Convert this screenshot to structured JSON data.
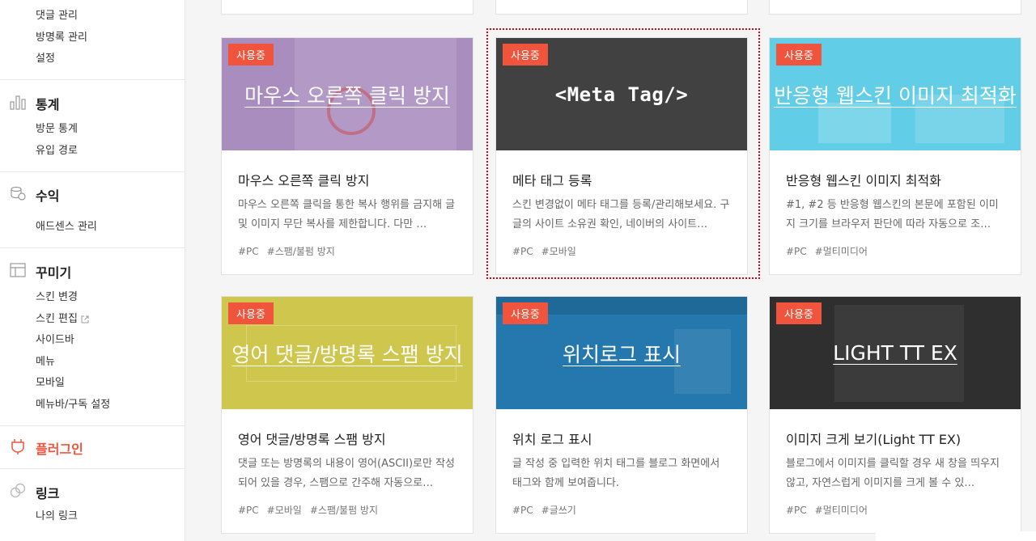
{
  "sidebar": {
    "comment_manage": "댓글 관리",
    "guestbook_manage": "방명록 관리",
    "settings": "설정",
    "stats": {
      "title": "통계",
      "items": [
        "방문 통계",
        "유입 경로"
      ]
    },
    "revenue": {
      "title": "수익",
      "items": [
        "애드센스 관리"
      ]
    },
    "decorate": {
      "title": "꾸미기",
      "items": [
        "스킨 변경",
        "스킨 편집",
        "사이드바",
        "메뉴",
        "모바일",
        "메뉴바/구독 설정"
      ]
    },
    "plugin": {
      "title": "플러그인"
    },
    "link": {
      "title": "링크",
      "items": [
        "나의 링크"
      ]
    }
  },
  "badge_label": "사용중",
  "cards": [
    {
      "thumb_text": "마우스 오른쪽 클릭 방지",
      "title": "마우스 오른쪽 클릭 방지",
      "desc": "마우스 오른쪽 클릭을 통한 복사 행위를 금지해 글 및 이미지 무단 복사를 제한합니다. 다만 …",
      "tags": [
        "#PC",
        "#스팸/불펌 방지"
      ],
      "color": "#a98dbf"
    },
    {
      "thumb_text": "<Meta Tag/>",
      "title": "메타 태그 등록",
      "desc": "스킨 변경없이 메타 태그를 등록/관리해보세요. 구글의 사이트 소유권 확인, 네이버의 사이트…",
      "tags": [
        "#PC",
        "#모바일"
      ],
      "color": "#414141"
    },
    {
      "thumb_text": "반응형 웹스킨 이미지 최적화",
      "title": "반응형 웹스킨 이미지 최적화",
      "desc": "#1, #2 등 반응형 웹스킨의 본문에 포함된 이미지 크기를 브라우저 판단에 따라 자동으로 조…",
      "tags": [
        "#PC",
        "#멀티미디어"
      ],
      "color": "#62cde6"
    },
    {
      "thumb_text": "영어 댓글/방명록 스팸 방지",
      "title": "영어 댓글/방명록 스팸 방지",
      "desc": "댓글 또는 방명록의 내용이 영어(ASCII)로만 작성되어 있을 경우, 스팸으로 간주해 자동으로…",
      "tags": [
        "#PC",
        "#모바일",
        "#스팸/불펌 방지"
      ],
      "color": "#cfc74d"
    },
    {
      "thumb_text": "위치로그 표시",
      "title": "위치 로그 표시",
      "desc": "글 작성 중 입력한 위치 태그를 블로그 화면에서 태그와 함께 보여줍니다.",
      "tags": [
        "#PC",
        "#글쓰기"
      ],
      "color": "#2478ad"
    },
    {
      "thumb_text": "LIGHT TT EX",
      "title": "이미지 크게 보기(Light TT EX)",
      "desc": "블로그에서 이미지를 클릭할 경우 새 창을 띄우지 않고, 자연스럽게 이미지를 크게 볼 수 있…",
      "tags": [
        "#PC",
        "#멀티미디어"
      ],
      "color": "#2f2f2f"
    }
  ]
}
